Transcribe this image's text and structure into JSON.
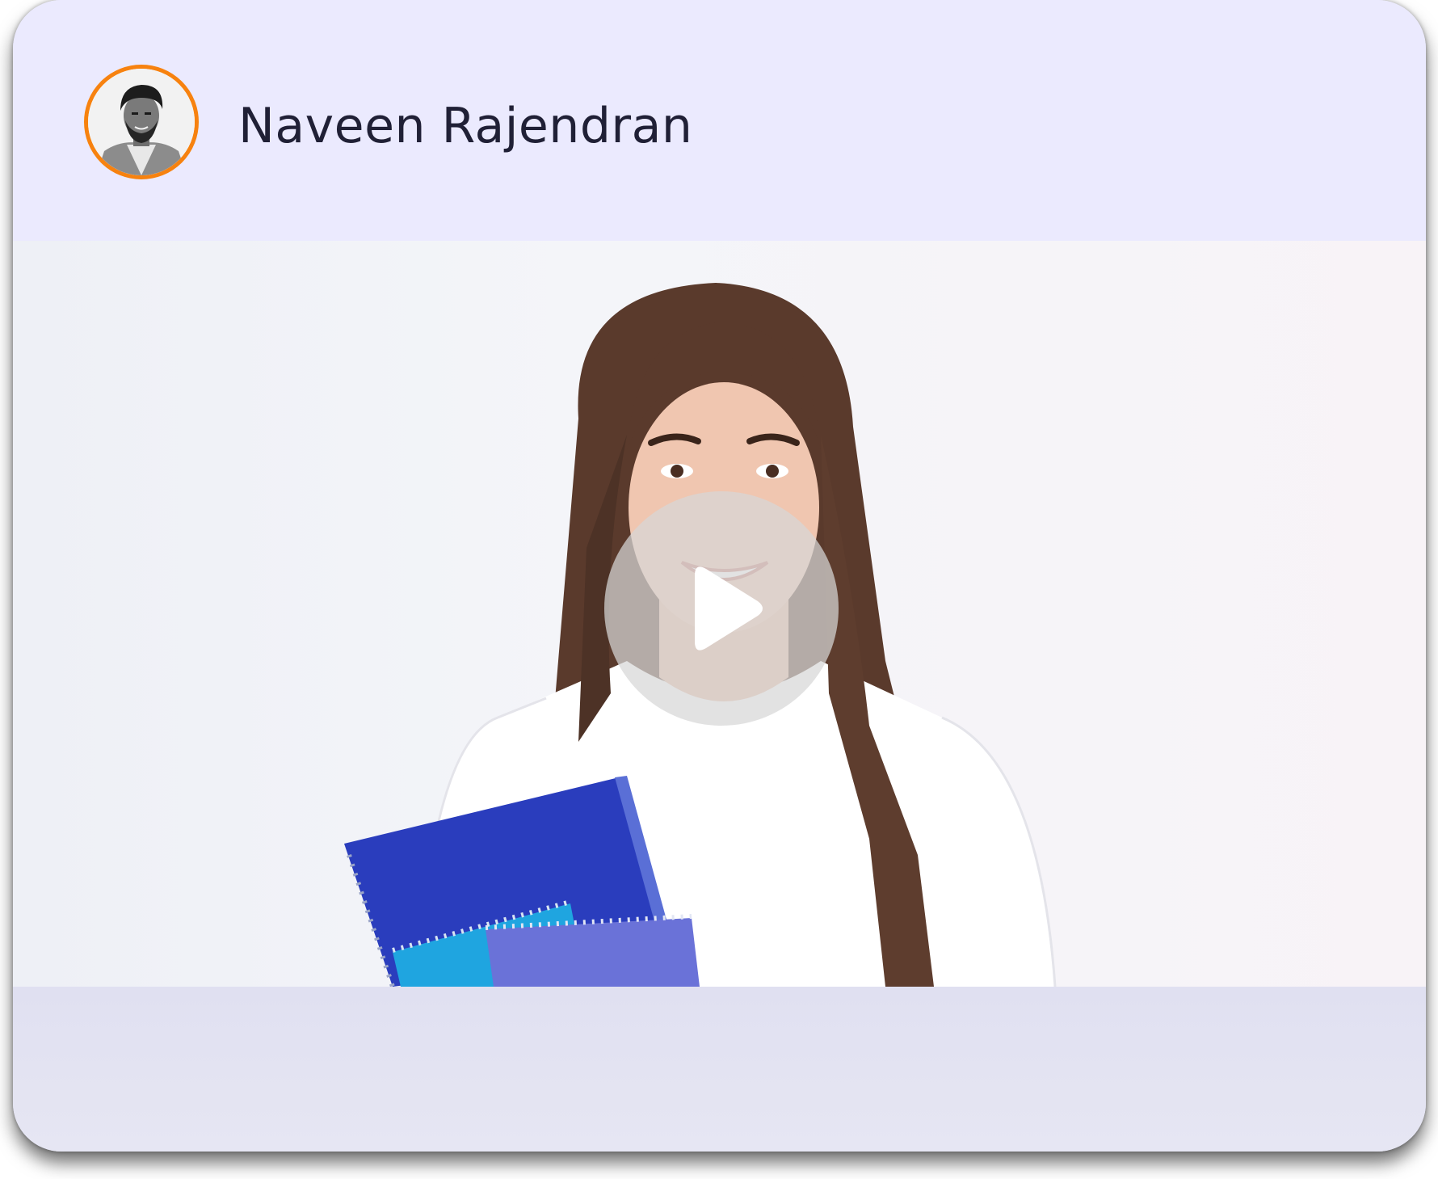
{
  "post": {
    "author_name": "Naveen Rajendran",
    "avatar_icon": "user-avatar-photo",
    "avatar_ring_color": "#f7820f"
  },
  "video": {
    "thumbnail": "student-holding-notebooks",
    "play_icon": "play-icon"
  },
  "colors": {
    "card_background": "#ebeafe",
    "footer_background": "#e2e2f2",
    "name_text": "#202036"
  }
}
